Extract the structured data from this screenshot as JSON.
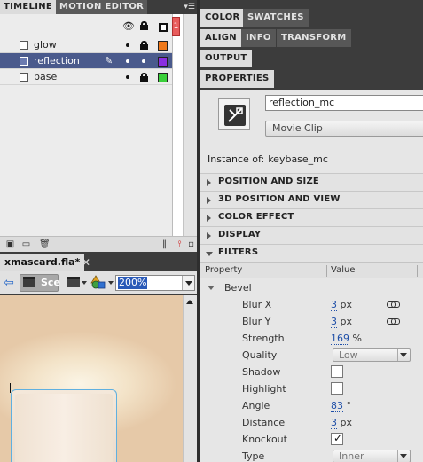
{
  "timeline": {
    "tabs": [
      {
        "label": "TIMELINE",
        "active": true
      },
      {
        "label": "MOTION EDITOR",
        "active": false
      }
    ],
    "playhead_frame": "1",
    "layers": [
      {
        "name": "glow",
        "color": "#f07818",
        "selected": false
      },
      {
        "name": "reflection",
        "color": "#8a2ee0",
        "selected": true
      },
      {
        "name": "base",
        "color": "#3ad03a",
        "selected": false
      }
    ]
  },
  "document": {
    "tab_label": "xmascard.fla*",
    "close_glyph": "✕",
    "scene_label": "Sce",
    "zoom": "200%"
  },
  "right_panels": {
    "row1": [
      {
        "label": "COLOR",
        "active": true
      },
      {
        "label": "SWATCHES",
        "active": false
      }
    ],
    "row2": [
      {
        "label": "ALIGN",
        "active": true
      },
      {
        "label": "INFO",
        "active": false
      },
      {
        "label": "TRANSFORM",
        "active": false
      }
    ],
    "row3": [
      {
        "label": "OUTPUT",
        "active": true
      }
    ],
    "row4": [
      {
        "label": "PROPERTIES",
        "active": true
      }
    ]
  },
  "properties": {
    "instance_name": "reflection_mc",
    "symbol_type": "Movie Clip",
    "instance_of_label": "Instance of:",
    "instance_of_value": "keybase_mc",
    "sections": [
      {
        "label": "POSITION AND SIZE",
        "open": false
      },
      {
        "label": "3D POSITION AND VIEW",
        "open": false
      },
      {
        "label": "COLOR EFFECT",
        "open": false
      },
      {
        "label": "DISPLAY",
        "open": false
      },
      {
        "label": "FILTERS",
        "open": true
      }
    ],
    "filters": {
      "col_property": "Property",
      "col_value": "Value",
      "group": "Bevel",
      "rows": [
        {
          "key": "Blur X",
          "num": "3",
          "unit": " px",
          "linked": true
        },
        {
          "key": "Blur Y",
          "num": "3",
          "unit": " px",
          "linked": true
        },
        {
          "key": "Strength",
          "num": "169",
          "unit": " %"
        },
        {
          "key": "Quality",
          "select": "Low"
        },
        {
          "key": "Shadow",
          "checkbox": false
        },
        {
          "key": "Highlight",
          "checkbox": false
        },
        {
          "key": "Angle",
          "num": "83",
          "unit": " °"
        },
        {
          "key": "Distance",
          "num": "3",
          "unit": " px"
        },
        {
          "key": "Knockout",
          "checkbox": true
        },
        {
          "key": "Type",
          "select": "Inner"
        }
      ]
    }
  }
}
